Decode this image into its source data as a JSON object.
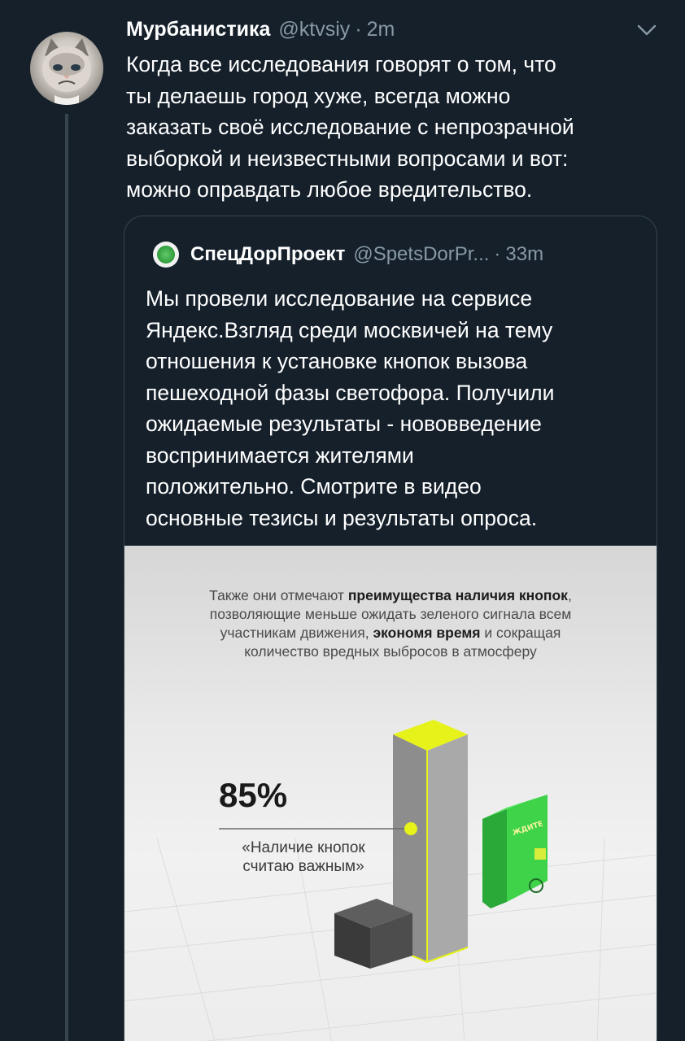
{
  "tweet": {
    "author_name": "Мурбанистика",
    "handle": "@ktvsiy",
    "separator": "·",
    "time": "2m",
    "lines": [
      "Когда все исследования говорят о том, что",
      "ты делаешь город хуже, всегда можно",
      "заказать своё исследование с непрозрачной",
      "выборкой и неизвестными вопросами и вот:",
      "можно оправдать любое вредительство."
    ]
  },
  "quoted": {
    "author_name": "СпецДорПроект",
    "handle": "@SpetsDorPr...",
    "separator": "·",
    "time": "33m",
    "lines": [
      "Мы провели исследование на сервисе",
      "Яндекс.Взгляд среди москвичей на тему",
      "отношения к установке кнопок вызова",
      "пешеходной фазы светофора. Получили",
      "ожидаемые результаты - нововведение",
      "воспринимается жителями",
      "положительно. Смотрите в видео",
      "основные тезисы и результаты опроса."
    ]
  },
  "media": {
    "caption": {
      "l1_a": "Также они отмечают ",
      "l1_b": "преимущества наличия кнопок",
      "l1_c": ",",
      "l2": "позволяющие меньше ожидать зеленого сигнала всем",
      "l3_a": "участникам движения, ",
      "l3_b": "экономя время",
      "l3_c": " и сокращая",
      "l4": "количество вредных выбросов в атмосферу"
    },
    "stat_percent": "85%",
    "stat_label_1": "«Наличие кнопок",
    "stat_label_2": "считаю важным»",
    "device_label": "ЖДИТЕ",
    "accent_yellow": "#e6f21a",
    "device_green": "#3fd34a"
  }
}
